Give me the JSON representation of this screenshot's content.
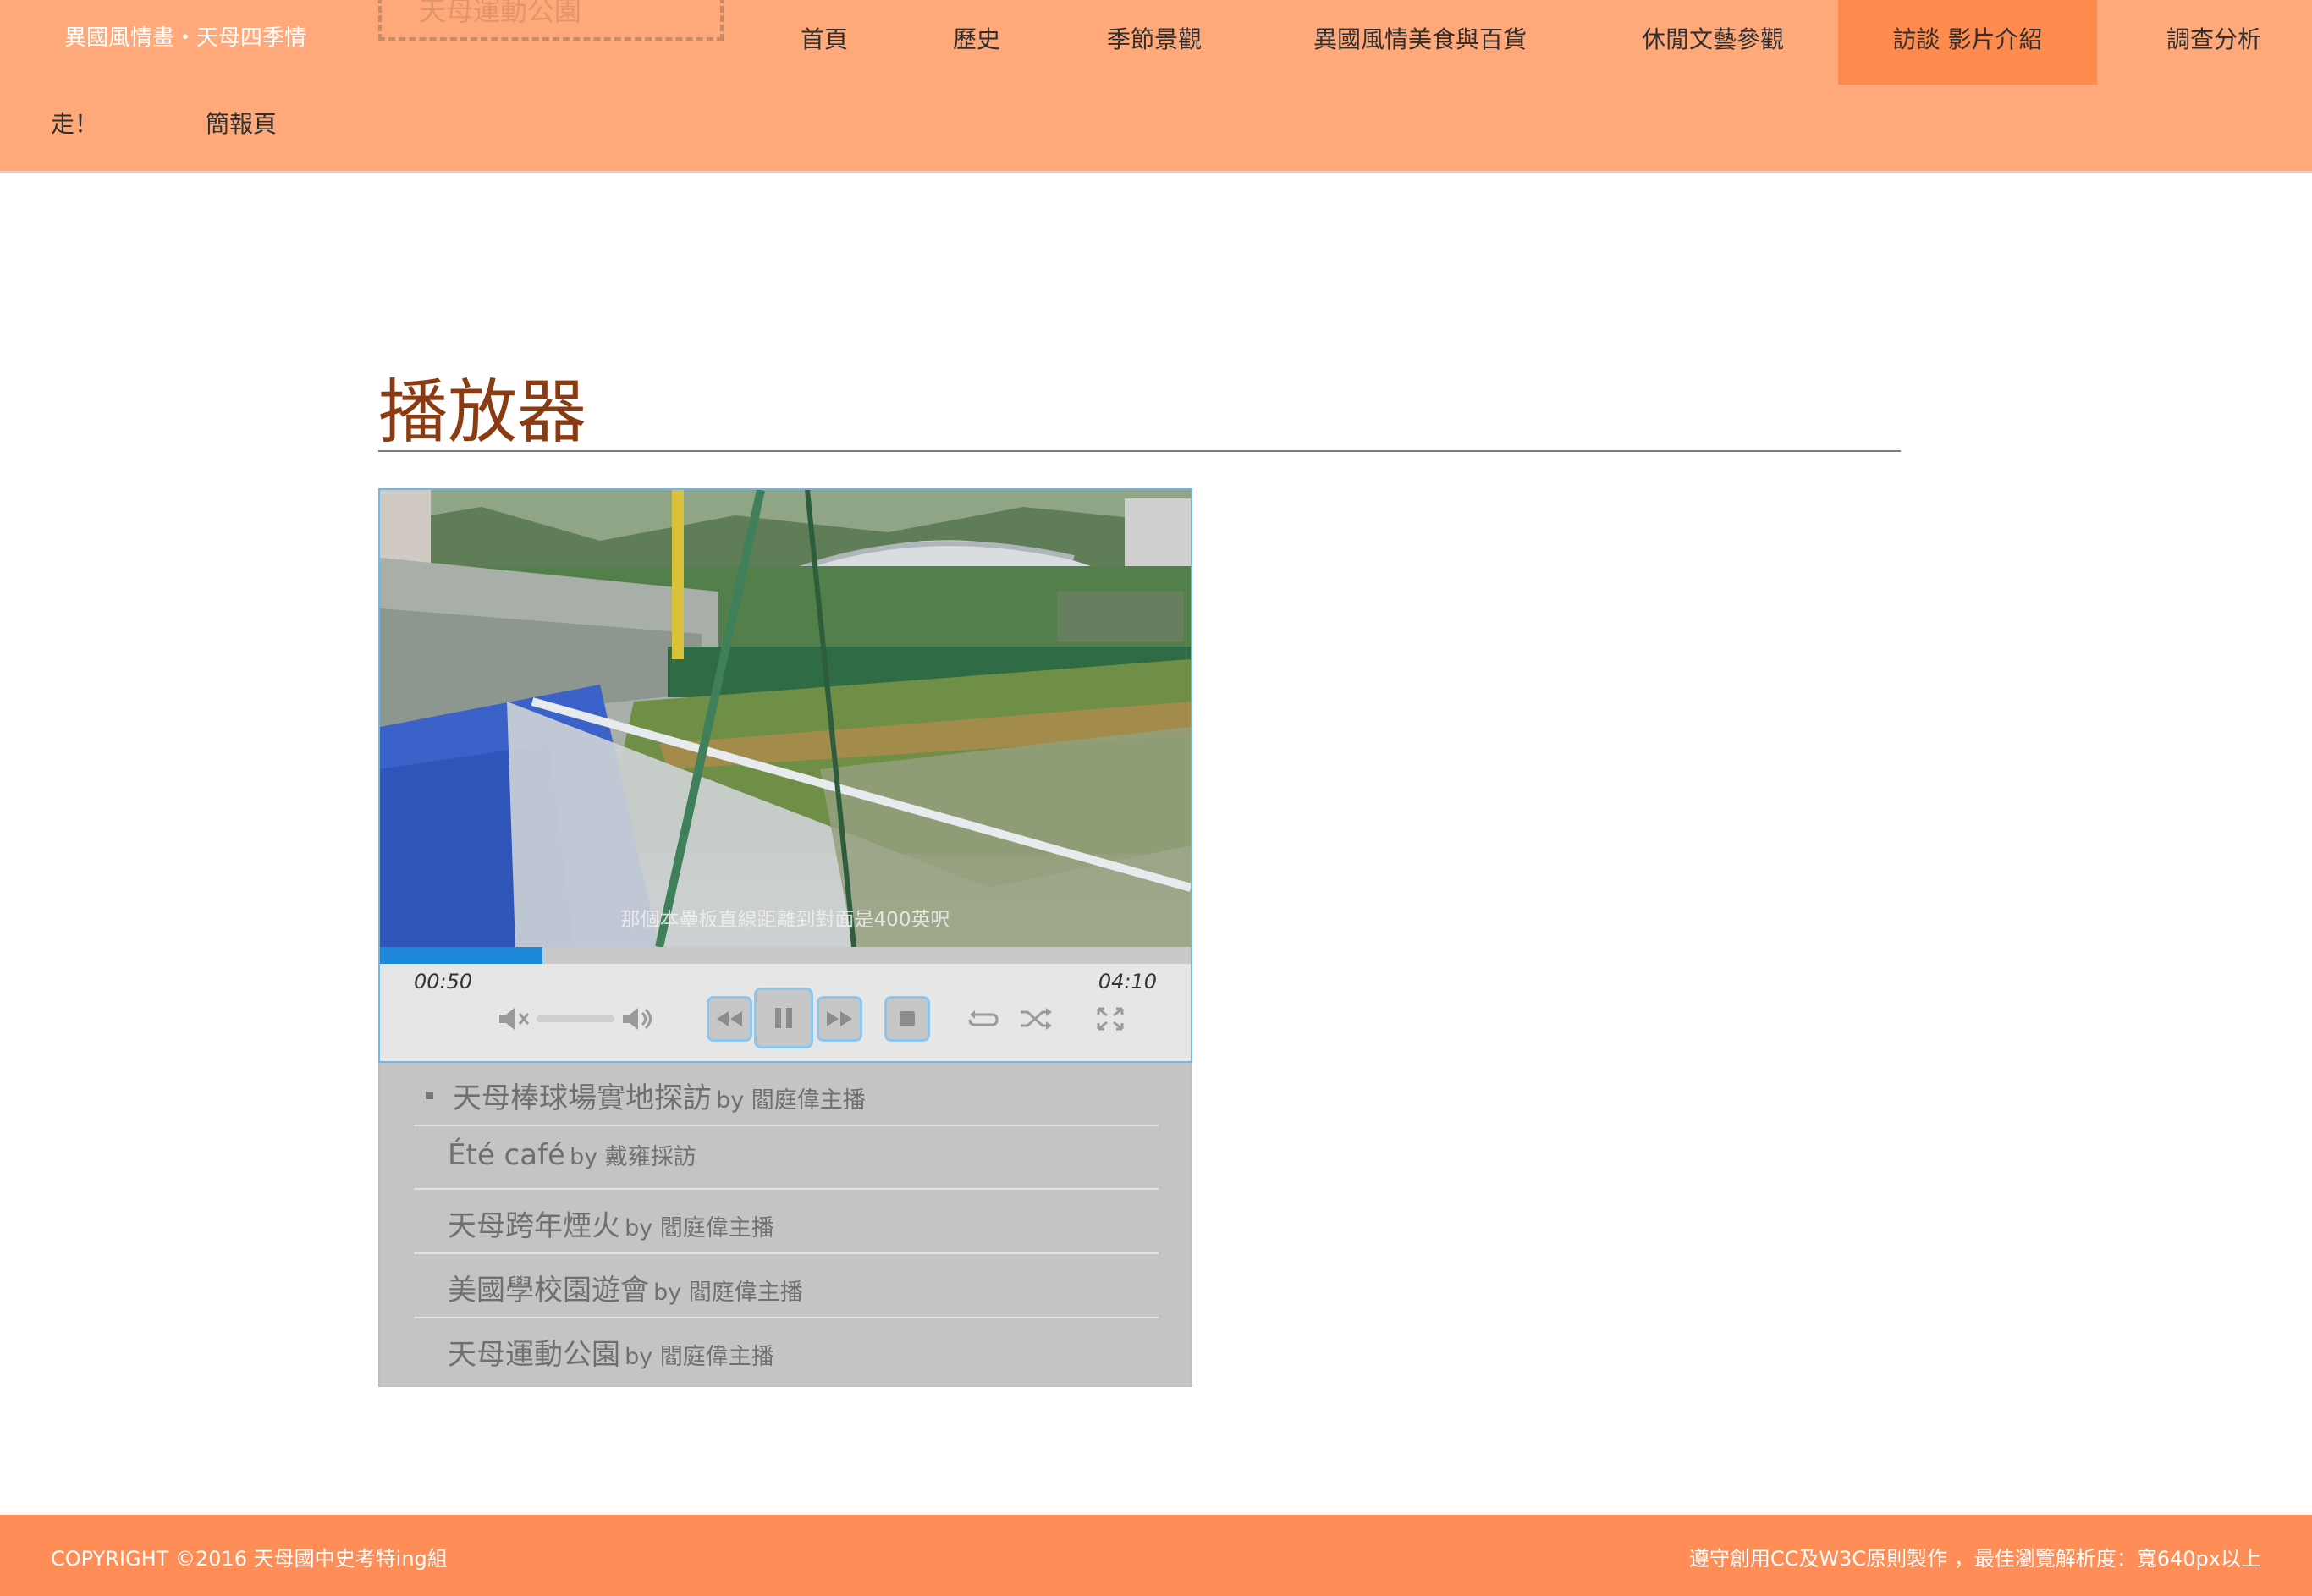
{
  "header": {
    "brand": "異國風情畫・天母四季情",
    "ghost_label": "天母運動公園",
    "nav": [
      {
        "label": "首頁"
      },
      {
        "label": "歷史"
      },
      {
        "label": "季節景觀"
      },
      {
        "label": "異國風情美食與百貨"
      },
      {
        "label": "休閒文藝參觀"
      },
      {
        "label": "訪談 影片介紹",
        "active": true
      },
      {
        "label": "調查分析"
      },
      {
        "label": "走！"
      },
      {
        "label": "簡報頁"
      }
    ]
  },
  "main": {
    "title": "播放器"
  },
  "player": {
    "subtitle": "那個本壘板直線距離到對面是400英呎",
    "current_time": "00:50",
    "duration": "04:10",
    "progress_percent": 20,
    "icons": {
      "mute": "mute-icon",
      "volume": "volume-icon",
      "rewind": "rewind-icon",
      "pause": "pause-icon",
      "forward": "fast-forward-icon",
      "stop": "stop-icon",
      "repeat": "repeat-icon",
      "shuffle": "shuffle-icon",
      "fullscreen": "fullscreen-icon"
    },
    "accent_color": "#1e88d8"
  },
  "playlist": [
    {
      "title": "天母棒球場實地探訪",
      "by": "by 閻庭偉主播",
      "current": true
    },
    {
      "title": "Été café",
      "by": "by 戴雍採訪"
    },
    {
      "title": "天母跨年煙火",
      "by": "by 閻庭偉主播"
    },
    {
      "title": "美國學校園遊會",
      "by": "by 閻庭偉主播"
    },
    {
      "title": "天母運動公園",
      "by": "by 閻庭偉主播"
    }
  ],
  "footer": {
    "copyright": "COPYRIGHT ©2016 天母國中史考特ing組",
    "notice": "遵守創用CC及W3C原則製作 ，最佳瀏覽解析度：寬640px以上"
  },
  "colors": {
    "header_bg": "#ffa97a",
    "nav_active_bg": "#ff8a4d",
    "footer_bg": "#ff8d57",
    "title_color": "#8b3b12"
  }
}
